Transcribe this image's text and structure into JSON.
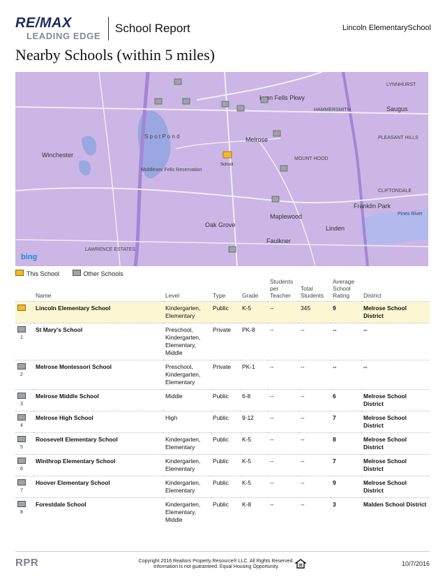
{
  "header": {
    "logo_top": "RE/MAX",
    "logo_bottom": "LEADING EDGE",
    "report_title": "School Report",
    "school_name": "Lincoln ElementarySchool"
  },
  "page_title": "Nearby Schools (within 5 miles)",
  "map": {
    "labels": {
      "school": "School",
      "winchester": "Winchester",
      "spot_pond": "S p o t   P o n d",
      "fells": "Middlesex Fells Reservation",
      "melrose": "Melrose",
      "mount_hood": "MOUNT HOOD",
      "maplewood": "Maplewood",
      "oak_grove": "Oak Grove",
      "franklin_park": "Franklin Park",
      "linden": "Linden",
      "faulkner": "Faulkner",
      "saugus": "Saugus",
      "lynnhurst": "LYNNHURST",
      "hammersmith": "HAMMERSMITH",
      "pleasant_hills": "PLEASANT HILLS",
      "cliftondale": "CLIFTONDALE",
      "pines_river": "Pines River",
      "lynn_fells": "Lynn Fells Pkwy",
      "lawrence": "LAWRENCE ESTATES",
      "bing": "bing"
    },
    "colors": {
      "base": "#cbb6e6",
      "road": "#f2ecf8",
      "water": "#9aa7e0",
      "highway": "#a485d6"
    }
  },
  "legend": {
    "this_school": "This School",
    "other_schools": "Other Schools"
  },
  "table": {
    "headers": {
      "name": "Name",
      "level": "Level",
      "type": "Type",
      "grade": "Grade",
      "spt": "Students per Teacher",
      "total": "Total Students",
      "rating": "Average School Rating",
      "district": "District"
    },
    "rows": [
      {
        "num": "",
        "name": "Lincoln Elementary School",
        "level": "Kindergarten, Elementary",
        "type": "Public",
        "grade": "K-5",
        "spt": "--",
        "total": "345",
        "rating": "9",
        "district": "Melrose School District"
      },
      {
        "num": "1",
        "name": "St Mary's School",
        "level": "Preschool, Kindergarten, Elementary, Middle",
        "type": "Private",
        "grade": "PK-8",
        "spt": "--",
        "total": "--",
        "rating": "--",
        "district": "--"
      },
      {
        "num": "2",
        "name": "Melrose Montessori School",
        "level": "Preschool, Kindergarten, Elementary",
        "type": "Private",
        "grade": "PK-1",
        "spt": "--",
        "total": "--",
        "rating": "--",
        "district": "--"
      },
      {
        "num": "3",
        "name": "Melrose Middle School",
        "level": "Middle",
        "type": "Public",
        "grade": "6-8",
        "spt": "--",
        "total": "--",
        "rating": "6",
        "district": "Melrose School District"
      },
      {
        "num": "4",
        "name": "Melrose High School",
        "level": "High",
        "type": "Public",
        "grade": "9-12",
        "spt": "--",
        "total": "--",
        "rating": "7",
        "district": "Melrose School District"
      },
      {
        "num": "5",
        "name": "Roosevelt Elementary School",
        "level": "Kindergarten, Elementary",
        "type": "Public",
        "grade": "K-5",
        "spt": "--",
        "total": "--",
        "rating": "8",
        "district": "Melrose School District"
      },
      {
        "num": "6",
        "name": "Winthrop Elementary School",
        "level": "Kindergarten, Elementary",
        "type": "Public",
        "grade": "K-5",
        "spt": "--",
        "total": "--",
        "rating": "7",
        "district": "Melrose School District"
      },
      {
        "num": "7",
        "name": "Hoover Elementary School",
        "level": "Kindergarten, Elementary",
        "type": "Public",
        "grade": "K-5",
        "spt": "--",
        "total": "--",
        "rating": "9",
        "district": "Melrose School District"
      },
      {
        "num": "8",
        "name": "Forestdale School",
        "level": "Kindergarten, Elementary, Middle",
        "type": "Public",
        "grade": "K-8",
        "spt": "--",
        "total": "--",
        "rating": "3",
        "district": "Malden School District"
      }
    ]
  },
  "footer": {
    "logo": "RPR",
    "copyright_1": "Copyright 2016 Realtors Property Resource® LLC. All Rights Reserved.",
    "copyright_2": "Information is not guaranteed. Equal Housing Opportunity.",
    "date": "10/7/2016"
  }
}
